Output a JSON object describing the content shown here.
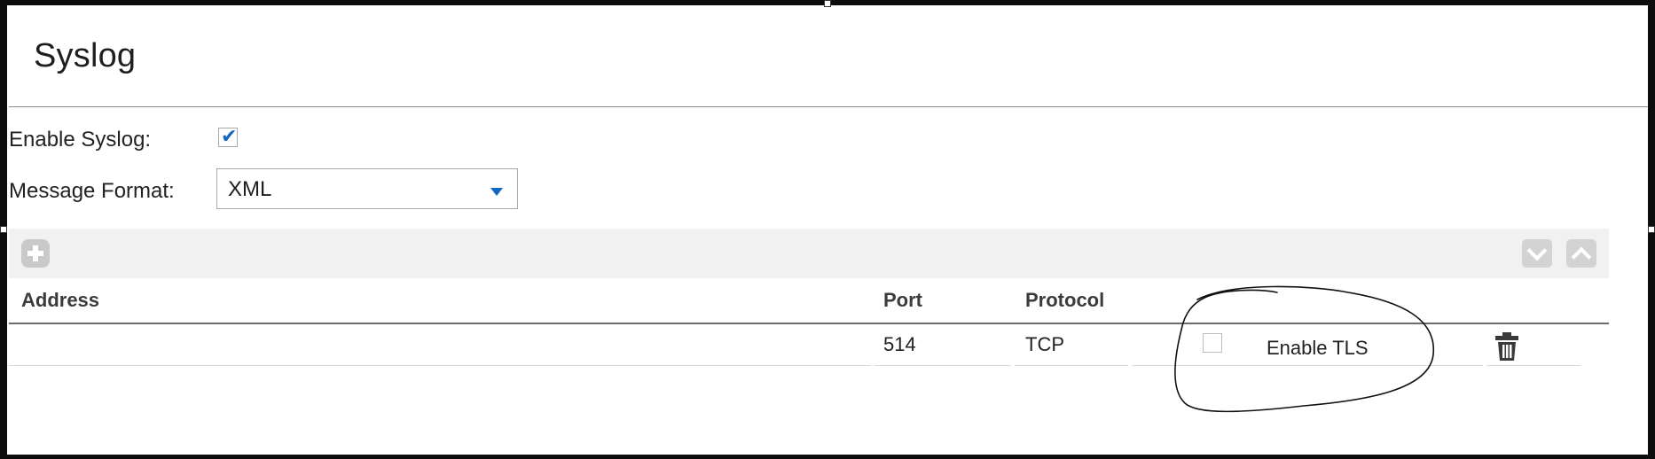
{
  "panel": {
    "title": "Syslog"
  },
  "form": {
    "enable_syslog_label": "Enable Syslog:",
    "enable_syslog_checked": true,
    "message_format_label": "Message Format:",
    "message_format_value": "XML"
  },
  "toolbar": {
    "add_icon": "plus-icon",
    "move_down_icon": "chevron-down-icon",
    "move_up_icon": "chevron-up-icon"
  },
  "table": {
    "columns": [
      "Address",
      "Port",
      "Protocol"
    ],
    "rows": [
      {
        "address": "",
        "port": "514",
        "protocol": "TCP",
        "enable_tls_checked": false,
        "enable_tls_label": "Enable TLS",
        "delete_icon": "trash-icon"
      }
    ]
  },
  "colors": {
    "accent": "#1565c0",
    "toolbar_bg": "#f1f1f1",
    "icon_bg": "#d3d3d3",
    "frame": "#0d0d0d"
  }
}
